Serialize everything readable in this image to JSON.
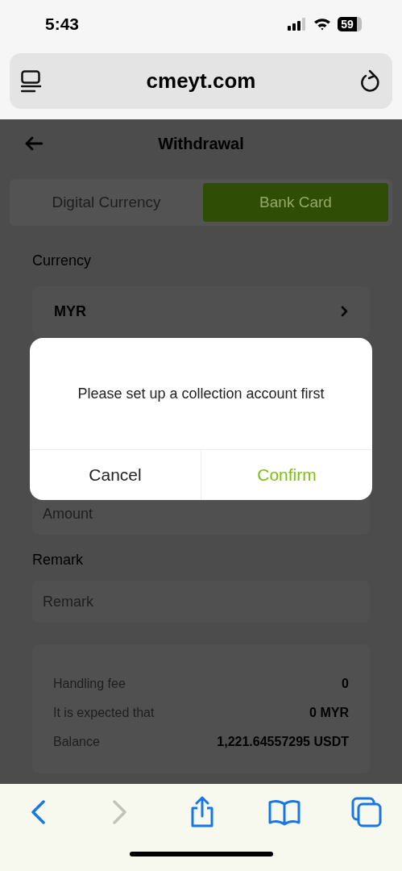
{
  "status_bar": {
    "time": "5:43",
    "battery": "59"
  },
  "browser": {
    "url": "cmeyt.com"
  },
  "header": {
    "title": "Withdrawal"
  },
  "tabs": [
    {
      "label": "Digital Currency",
      "selected": false
    },
    {
      "label": "Bank Card",
      "selected": true
    }
  ],
  "currency": {
    "label": "Currency",
    "value": "MYR"
  },
  "amount": {
    "placeholder": "Amount"
  },
  "remark": {
    "label": "Remark",
    "placeholder": "Remark"
  },
  "summary": [
    {
      "label": "Handling fee",
      "value": "0"
    },
    {
      "label": "It is expected that",
      "value": "0 MYR"
    },
    {
      "label": "Balance",
      "value": "1,221.64557295 USDT"
    }
  ],
  "dialog": {
    "message": "Please set up a collection account first",
    "buttons": [
      {
        "label": "Cancel",
        "kind": "cancel"
      },
      {
        "label": "Confirm",
        "kind": "confirm"
      }
    ]
  },
  "toolbar": [
    {
      "kind": "back",
      "disabled": false
    },
    {
      "kind": "forward",
      "disabled": true
    },
    {
      "kind": "share",
      "disabled": false
    },
    {
      "kind": "bookmarks",
      "disabled": false
    },
    {
      "kind": "tabs",
      "disabled": false
    }
  ]
}
